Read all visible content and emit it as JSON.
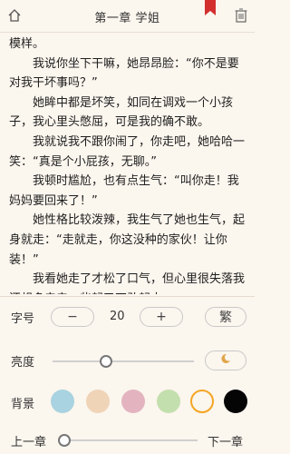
{
  "header": {
    "title": "第一章 学姐"
  },
  "content": {
    "paragraphs": [
      {
        "text": "模样。",
        "indent": false
      },
      {
        "text": "我说你坐下干嘛，她昂昂脸：“你不是要对我干坏事吗？”",
        "indent": true
      },
      {
        "text": "她眸中都是坏笑，如同在调戏一个小孩子，我心里头憋屈，可是我的确不敢。",
        "indent": true
      },
      {
        "text": "我就说我不跟你闹了，你走吧，她哈哈一笑：“真是个小屁孩，无聊。”",
        "indent": true
      },
      {
        "text": "我顿时尴尬，也有点生气：“叫你走！我妈妈要回来了！”",
        "indent": true
      },
      {
        "text": "她性格比较泼辣，我生气了她也生气，起身就走：“走就走，你这没种的家伙！让你装！”",
        "indent": true
      },
      {
        "text": "我看她走了才松了口气，但心里很失落我还想多亲亲，些起又不敢起去",
        "indent": true
      }
    ]
  },
  "settings": {
    "font_size_label": "字号",
    "decrease": "−",
    "font_size_value": "20",
    "increase": "+",
    "traditional": "繁",
    "brightness_label": "亮度",
    "brightness_level": 0.38,
    "night_mode_icon": "moon-icon",
    "background_label": "背景",
    "background_colors": [
      "#a9d3e0",
      "#f0d4b8",
      "#e3b4c0",
      "#c4dfae",
      "#fbf6ee",
      "#050505"
    ],
    "selected_background_index": 4,
    "prev_chapter": "上一章",
    "next_chapter": "下一章",
    "chapter_progress": 0.03
  },
  "colors": {
    "bookmark": "#d32f2f",
    "selected_ring": "#f5a524"
  }
}
